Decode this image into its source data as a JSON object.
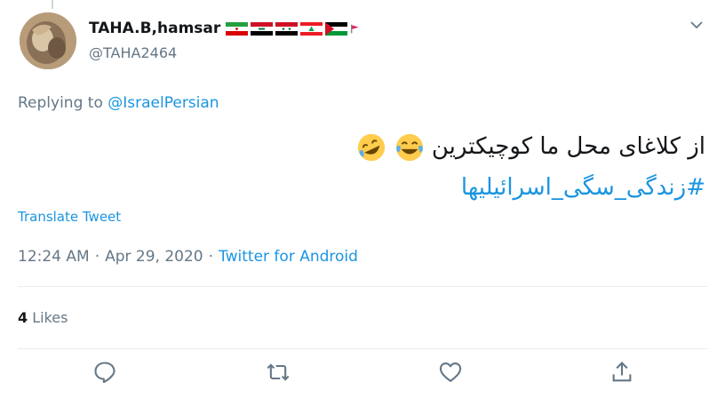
{
  "user": {
    "display_name": "TAHA.B,hamsar",
    "handle": "@TAHA2464",
    "flags": [
      "iran-flag-icon",
      "iraq-flag-icon",
      "syria-flag-icon",
      "lebanon-flag-icon",
      "palestine-flag-icon",
      "red-flag-icon"
    ]
  },
  "reply": {
    "prefix": "Replying to",
    "mention": "@IsraelPersian"
  },
  "tweet": {
    "line1": "از کلاغای محل ما کوچیکترین",
    "hashtag": "#زندگی_سگی_اسرائیلیها"
  },
  "translate_label": "Translate Tweet",
  "meta": {
    "time": "12:24 AM",
    "sep1": "·",
    "date": "Apr 29, 2020",
    "sep2": "·",
    "source": "Twitter for Android"
  },
  "stats": {
    "likes_count": "4",
    "likes_label": "Likes"
  },
  "colors": {
    "link": "#1b95e0",
    "muted": "#657786",
    "text": "#14171a",
    "border": "#e6ecf0"
  }
}
